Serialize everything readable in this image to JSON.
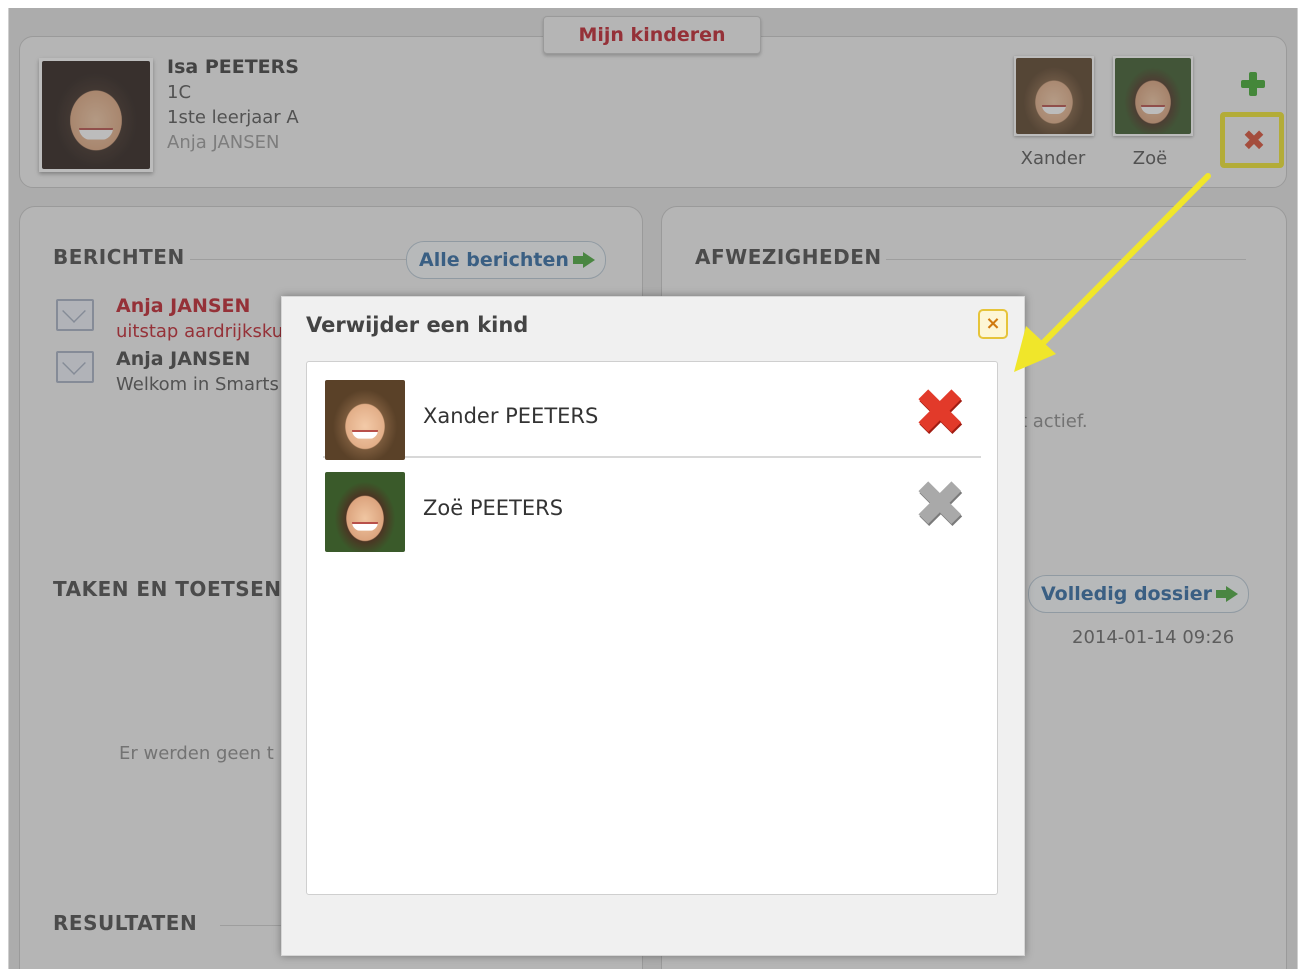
{
  "tab": {
    "label": "Mijn kinderen"
  },
  "profile": {
    "name": "Isa PEETERS",
    "class": "1C",
    "grade": "1ste leerjaar A",
    "teacher": "Anja JANSEN"
  },
  "children": [
    {
      "label": "Xander"
    },
    {
      "label": "Zoë"
    }
  ],
  "messages": {
    "title": "BERICHTEN",
    "all_button": "Alle berichten",
    "items": [
      {
        "from": "Anja JANSEN",
        "subject": "uitstap aardrijksku",
        "unread": true
      },
      {
        "from": "Anja JANSEN",
        "subject": "Welkom in Smarts",
        "unread": false
      }
    ]
  },
  "absences": {
    "title": "AFWEZIGHEDEN",
    "status_fragment": "t actief."
  },
  "tasks": {
    "title": "TAKEN EN TOETSEN '",
    "empty_fragment": "Er werden geen t"
  },
  "dossier": {
    "button": "Volledig dossier",
    "timestamp": "2014-01-14 09:26"
  },
  "results": {
    "title": "RESULTATEN"
  },
  "modal": {
    "title": "Verwijder een kind",
    "close_symbol": "×",
    "rows": [
      {
        "name": "Xander PEETERS",
        "remove_state": "active"
      },
      {
        "name": "Zoë PEETERS",
        "remove_state": "disabled"
      }
    ]
  },
  "colors": {
    "accent_red": "#c0202a",
    "link_blue": "#2e6aa4",
    "highlight_yellow": "#f0e62a",
    "add_green": "#3eaa2e"
  }
}
